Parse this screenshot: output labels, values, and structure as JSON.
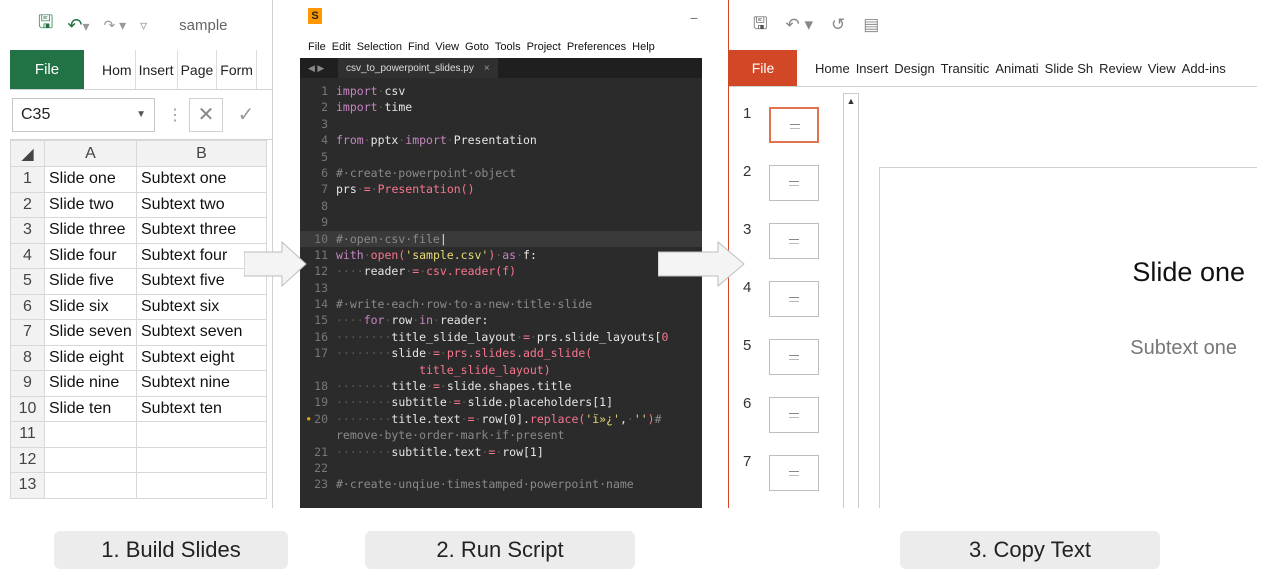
{
  "excel": {
    "filename": "sample",
    "tabs": [
      "File",
      "Hom",
      "Insert",
      "Page",
      "Form"
    ],
    "name_box": "C35",
    "columns": [
      "A",
      "B"
    ],
    "rows": [
      {
        "num": "1",
        "a": "Slide one",
        "b": "Subtext one"
      },
      {
        "num": "2",
        "a": "Slide two",
        "b": "Subtext two"
      },
      {
        "num": "3",
        "a": "Slide three",
        "b": "Subtext three"
      },
      {
        "num": "4",
        "a": "Slide four",
        "b": "Subtext four"
      },
      {
        "num": "5",
        "a": "Slide five",
        "b": "Subtext five"
      },
      {
        "num": "6",
        "a": "Slide six",
        "b": "Subtext six"
      },
      {
        "num": "7",
        "a": "Slide seven",
        "b": "Subtext seven"
      },
      {
        "num": "8",
        "a": "Slide eight",
        "b": "Subtext eight"
      },
      {
        "num": "9",
        "a": "Slide nine",
        "b": "Subtext nine"
      },
      {
        "num": "10",
        "a": "Slide ten",
        "b": "Subtext ten"
      },
      {
        "num": "11",
        "a": "",
        "b": ""
      },
      {
        "num": "12",
        "a": "",
        "b": ""
      },
      {
        "num": "13",
        "a": "",
        "b": ""
      }
    ]
  },
  "sublime": {
    "menu": [
      "File",
      "Edit",
      "Selection",
      "Find",
      "View",
      "Goto",
      "Tools",
      "Project",
      "Preferences",
      "Help"
    ],
    "tab_label": "csv_to_powerpoint_slides.py",
    "tab_close": "×"
  },
  "ppt": {
    "tabs": [
      "File",
      "Home",
      "Insert",
      "Design",
      "Transitic",
      "Animati",
      "Slide Sh",
      "Review",
      "View",
      "Add-ins"
    ],
    "thumbnails": [
      "1",
      "2",
      "3",
      "4",
      "5",
      "6",
      "7"
    ],
    "slide_title": "Slide one",
    "slide_subtitle": "Subtext one"
  },
  "steps": [
    "1. Build Slides",
    "2. Run Script",
    "3. Copy Text"
  ],
  "colors": {
    "excel_green": "#217346",
    "ppt_orange": "#d24726",
    "editor_bg": "#2b2b2b"
  }
}
